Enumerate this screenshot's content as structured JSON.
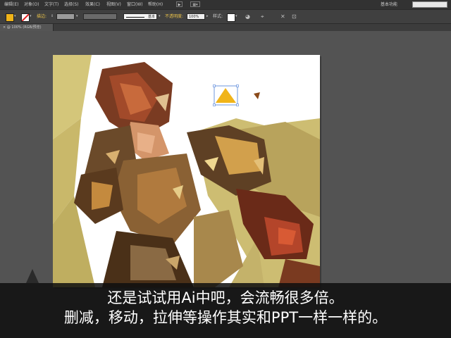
{
  "menu": {
    "items": [
      "编辑(E)",
      "对象(O)",
      "文字(T)",
      "选择(S)",
      "效果(C)",
      "视图(V)",
      "窗口(W)",
      "帮助(H)"
    ],
    "workspace": "基本功能"
  },
  "control_bar": {
    "fill_color": "#f0b419",
    "stroke_label": "描边:",
    "stroke_profile": "基本",
    "opacity_label": "不透明度:",
    "opacity_value": "100%",
    "style_label": "样式:"
  },
  "document": {
    "tab_label": "@ 100% (RGB/预览)",
    "close_glyph": "×"
  },
  "caption": {
    "line1": "还是试试用Ai中吧，会流畅很多倍。",
    "line2": "删减，移动，拉伸等操作其实和PPT一样一样的。"
  },
  "colors": {
    "ui_dark": "#323232",
    "ui_mid": "#404040",
    "canvas_bg": "#535353",
    "accent_yellow": "#f0b419"
  }
}
